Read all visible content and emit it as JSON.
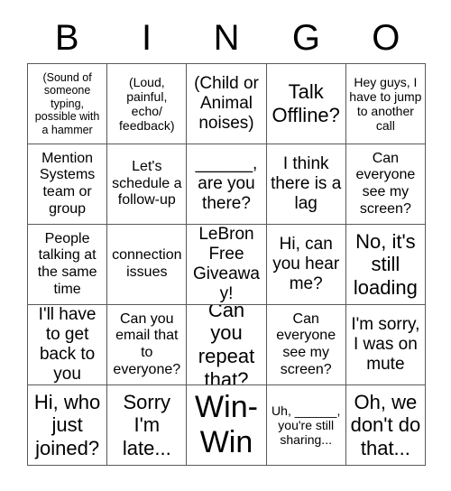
{
  "card": {
    "title": "BINGO",
    "header_letters": [
      "B",
      "I",
      "N",
      "G",
      "O"
    ],
    "border_color": "#595959",
    "background_color": "#ffffff",
    "text_color": "#000000",
    "rows": 5,
    "columns": 5,
    "cells": [
      {
        "text": "(Sound of someone typing, possible with a hammer",
        "size": "fs-xs"
      },
      {
        "text": "(Loud, painful, echo/ feedback)",
        "size": "fs-sm"
      },
      {
        "text": "(Child or Animal noises)",
        "size": "fs-lg"
      },
      {
        "text": "Talk Offline?",
        "size": "fs-xl"
      },
      {
        "text": "Hey guys, I have to jump to another call",
        "size": "fs-sm"
      },
      {
        "text": "Mention Systems team or group",
        "size": "fs-md"
      },
      {
        "text": "Let's schedule a follow-up",
        "size": "fs-md"
      },
      {
        "text": "______, are you there?",
        "size": "fs-lg"
      },
      {
        "text": "I think there is a lag",
        "size": "fs-lg"
      },
      {
        "text": "Can everyone see my screen?",
        "size": "fs-md"
      },
      {
        "text": "People talking at the same time",
        "size": "fs-md"
      },
      {
        "text": "connection issues",
        "size": "fs-md"
      },
      {
        "text": "LeBron Free Giveaway!",
        "size": "fs-lg"
      },
      {
        "text": "Hi, can you hear me?",
        "size": "fs-lg"
      },
      {
        "text": "No, it's still loading",
        "size": "fs-xl"
      },
      {
        "text": "I'll have to get back to you",
        "size": "fs-lg"
      },
      {
        "text": "Can you email that to everyone?",
        "size": "fs-md"
      },
      {
        "text": "Can you repeat that?",
        "size": "fs-xl"
      },
      {
        "text": "Can everyone see my screen?",
        "size": "fs-md"
      },
      {
        "text": "I'm sorry, I was on mute",
        "size": "fs-lg"
      },
      {
        "text": "Hi, who just joined?",
        "size": "fs-xl"
      },
      {
        "text": "Sorry I'm late...",
        "size": "fs-xl"
      },
      {
        "text": "Win-Win",
        "size": "fs-xxl"
      },
      {
        "text": "Uh, ______, you're still sharing...",
        "size": "fs-sm"
      },
      {
        "text": "Oh, we don't do that...",
        "size": "fs-xl"
      }
    ]
  }
}
